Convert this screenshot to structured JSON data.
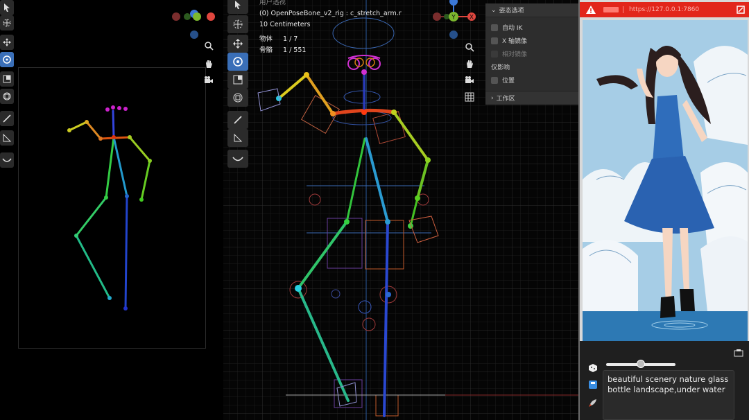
{
  "viewport_info": {
    "mode_label": "用户透视",
    "bone_line": "(0) OpenPoseBone_v2_rig : c_stretch_arm.r",
    "scale_line": "10 Centimeters",
    "objects_label": "物体",
    "objects_value": "1 / 7",
    "bones_label": "骨骼",
    "bones_value": "1 / 551"
  },
  "axes": {
    "x": "X",
    "y": "Y",
    "z": "Z"
  },
  "pose_panel": {
    "title": "姿态选项",
    "auto_ik": "自动 IK",
    "x_mirror": "X 轴镜像",
    "relative_mirror": "相对镜像",
    "affect_only": "仅影响",
    "location": "位置",
    "workspace": "工作区"
  },
  "browser": {
    "url": "https://127.0.0.1:7860"
  },
  "prompt": {
    "text": "beautiful scenery nature glass bottle landscape,under water"
  },
  "slider": {
    "value": 0.5
  },
  "colors": {
    "accent_blue": "#3a6fb8",
    "axis_x": "#e0463e",
    "axis_y": "#7cb82f",
    "axis_z": "#3b78d8",
    "browser_bar": "#e2261b"
  },
  "icons": {
    "tools": [
      "cursor-icon",
      "crosshair-icon",
      "move-icon",
      "rotate-icon",
      "scale-icon",
      "transform-icon",
      "annotate-icon",
      "measure-icon",
      "bone-curve-icon"
    ],
    "nav": [
      "zoom-icon",
      "hand-icon",
      "camera-icon",
      "grid-icon"
    ],
    "bottom": [
      "dice-icon",
      "save-icon",
      "rocket-icon"
    ]
  }
}
